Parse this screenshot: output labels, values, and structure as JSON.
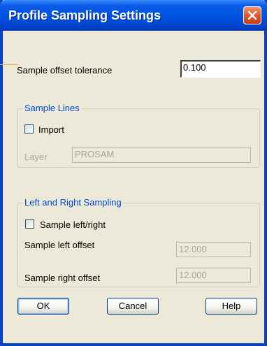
{
  "window": {
    "title": "Profile Sampling Settings"
  },
  "tolerance": {
    "label": "Sample offset tolerance",
    "value": "0.100"
  },
  "sample_lines": {
    "title": "Sample Lines",
    "import_label": "Import",
    "import_checked": false,
    "layer_label": "Layer",
    "layer_value": "PROSAM"
  },
  "left_right": {
    "title": "Left and Right Sampling",
    "checkbox_label": "Sample left/right",
    "checkbox_checked": false,
    "left_label": "Sample left offset",
    "left_value": "12.000",
    "right_label": "Sample right offset",
    "right_value": "12.000"
  },
  "buttons": {
    "ok": "OK",
    "cancel": "Cancel",
    "help": "Help"
  },
  "colors": {
    "titlebar": "#0054e3",
    "dialog_bg": "#ece9d8",
    "group_title": "#0046d5",
    "close_button": "#e45b31"
  }
}
